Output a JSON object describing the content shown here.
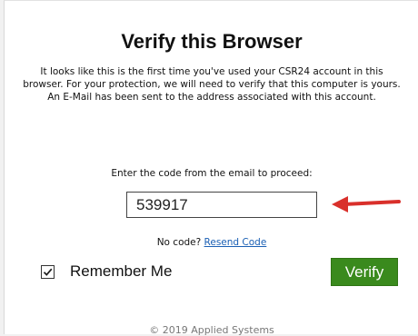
{
  "page": {
    "title": "Verify this Browser",
    "description": "It looks like this is the first time you've used your CSR24 account in this browser. For your protection, we will need to verify that this computer is yours. An E-Mail has been sent to the address associated with this account.",
    "prompt": "Enter the code from the email to proceed:",
    "code_value": "539917",
    "no_code_text": "No code?",
    "resend_link": "Resend Code",
    "remember_label": "Remember Me",
    "remember_checked": true,
    "verify_button": "Verify",
    "footer": "© 2019 Applied Systems"
  },
  "colors": {
    "verify_button": "#3a8a1d",
    "arrow": "#d9302b",
    "link": "#1a5fb4"
  },
  "icons": {
    "checkbox": "checkmark-icon",
    "annotation": "red-arrow-icon"
  }
}
